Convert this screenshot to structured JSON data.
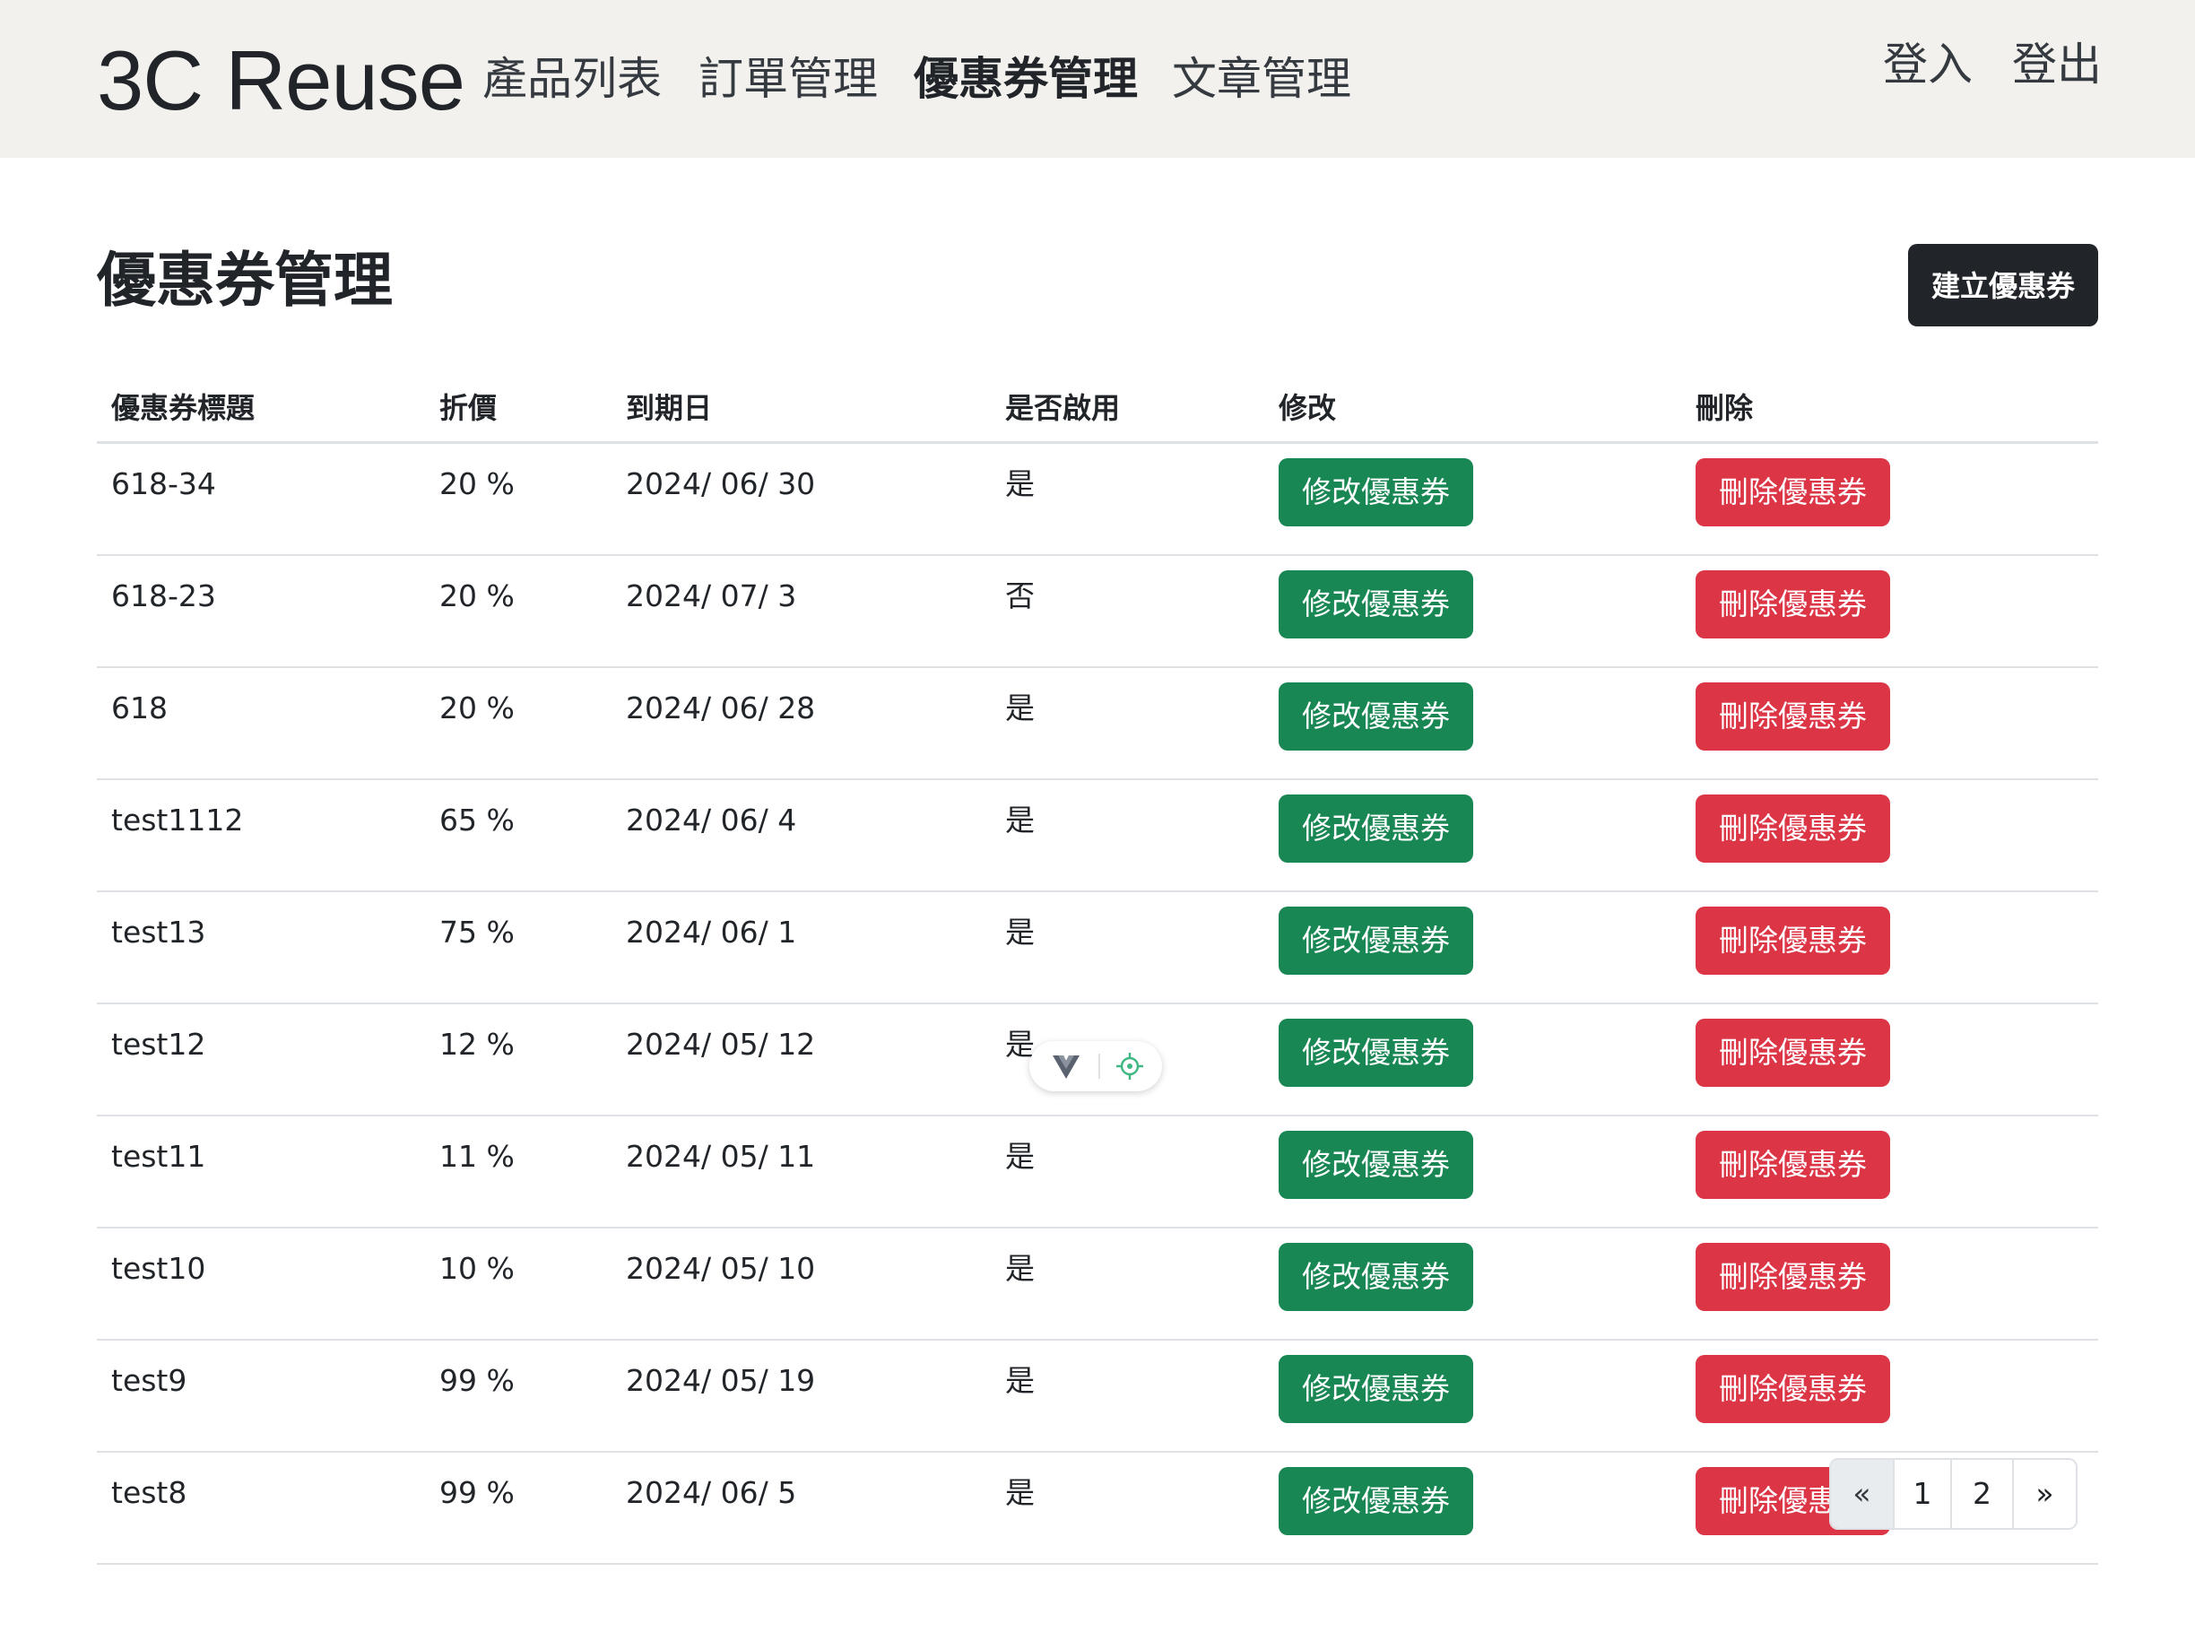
{
  "navbar": {
    "brand": "3C Reuse",
    "links": [
      "產品列表",
      "訂單管理",
      "優惠券管理",
      "文章管理"
    ],
    "active_link": "優惠券管理",
    "login": "登入",
    "logout": "登出"
  },
  "page": {
    "title": "優惠券管理",
    "create_button": "建立優惠券"
  },
  "table": {
    "headers": [
      "優惠券標題",
      "折價",
      "到期日",
      "是否啟用",
      "修改",
      "刪除"
    ],
    "edit_label": "修改優惠券",
    "delete_label": "刪除優惠券",
    "rows": [
      {
        "title": "618-34",
        "discount": "20 %",
        "due": "2024/ 06/ 30",
        "enabled": "是"
      },
      {
        "title": "618-23",
        "discount": "20 %",
        "due": "2024/ 07/ 3",
        "enabled": "否"
      },
      {
        "title": "618",
        "discount": "20 %",
        "due": "2024/ 06/ 28",
        "enabled": "是"
      },
      {
        "title": "test1112",
        "discount": "65 %",
        "due": "2024/ 06/ 4",
        "enabled": "是"
      },
      {
        "title": "test13",
        "discount": "75 %",
        "due": "2024/ 06/ 1",
        "enabled": "是"
      },
      {
        "title": "test12",
        "discount": "12 %",
        "due": "2024/ 05/ 12",
        "enabled": "是"
      },
      {
        "title": "test11",
        "discount": "11 %",
        "due": "2024/ 05/ 11",
        "enabled": "是"
      },
      {
        "title": "test10",
        "discount": "10 %",
        "due": "2024/ 05/ 10",
        "enabled": "是"
      },
      {
        "title": "test9",
        "discount": "99 %",
        "due": "2024/ 05/ 19",
        "enabled": "是"
      },
      {
        "title": "test8",
        "discount": "99 %",
        "due": "2024/ 06/ 5",
        "enabled": "是"
      }
    ]
  },
  "pagination": {
    "prev": "«",
    "pages": [
      "1",
      "2"
    ],
    "next": "»",
    "prev_disabled": true
  },
  "devtools_widget": {
    "icons": [
      "vue-logo-icon",
      "crosshair-target-icon"
    ],
    "accent": "#41b883"
  },
  "colors": {
    "navbar_bg": "#f2f1ee",
    "primary_dark": "#212529",
    "edit_green": "#198754",
    "delete_red": "#dc3545"
  }
}
